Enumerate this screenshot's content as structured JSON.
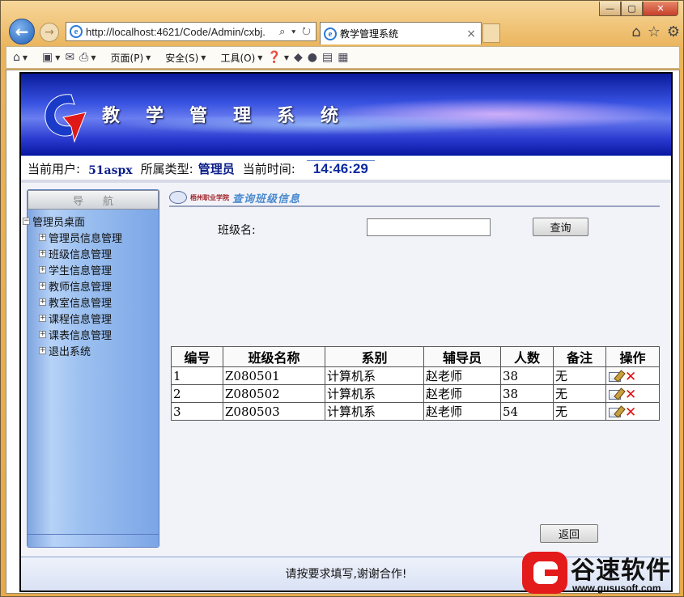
{
  "browser": {
    "url": "http://localhost:4621/Code/Admin/cxbj.",
    "address_tools": "⌕ ▾ ↻",
    "tab_title": "教学管理系统",
    "tab_close": "×",
    "window_buttons": [
      "—",
      "▢",
      "✕"
    ],
    "commands": {
      "page": "页面(P)",
      "safety": "安全(S)",
      "tools": "工具(O)"
    }
  },
  "banner": {
    "title": "教学管理系统"
  },
  "infobar": {
    "user_label": "当前用户:",
    "user_name": "51aspx",
    "type_label": "所属类型:",
    "type_value": "管理员",
    "time_label": "当前时间:",
    "time_value": "14:46:29"
  },
  "sidebar": {
    "header": "导航",
    "root": "管理员桌面",
    "items": [
      {
        "label": "管理员信息管理"
      },
      {
        "label": "班级信息管理"
      },
      {
        "label": "学生信息管理"
      },
      {
        "label": "教师信息管理"
      },
      {
        "label": "教室信息管理"
      },
      {
        "label": "课程信息管理"
      },
      {
        "label": "课表信息管理"
      },
      {
        "label": "退出系统"
      }
    ]
  },
  "main": {
    "school": "梧州职业学院",
    "page_title": "查询班级信息",
    "search_label": "班级名:",
    "search_value": "",
    "search_button": "查询",
    "back_button": "返回",
    "table": {
      "headers": [
        "编号",
        "班级名称",
        "系别",
        "辅导员",
        "人数",
        "备注",
        "操作"
      ],
      "rows": [
        [
          "1",
          "Z080501",
          "计算机系",
          "赵老师",
          "38",
          "无"
        ],
        [
          "2",
          "Z080502",
          "计算机系",
          "赵老师",
          "38",
          "无"
        ],
        [
          "3",
          "Z080503",
          "计算机系",
          "赵老师",
          "54",
          "无"
        ]
      ]
    }
  },
  "footer": {
    "message": "请按要求填写,谢谢合作!"
  },
  "watermark": {
    "name": "谷速软件",
    "url": "www.gususoft.com"
  },
  "colors": {
    "banner": "#2a3ad0",
    "accent": "#0b1d8a",
    "delete": "#e01010"
  }
}
